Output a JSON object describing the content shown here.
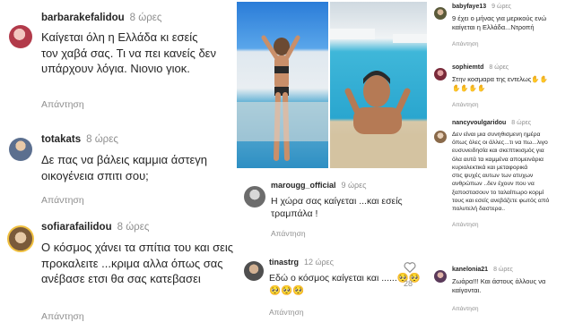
{
  "left": {
    "comments": [
      {
        "username": "barbarakefalidou",
        "time": "8 ώρες",
        "lines": [
          "Καίγεται όλη η Ελλάδα  κι εσείς",
          "τον χαβά σας. Τι να πει κανείς δεν",
          "υπάρχουν λόγια. Νιονιο γιοκ."
        ],
        "reply": "Απάντηση"
      },
      {
        "username": "totakats",
        "time": "8 ώρες",
        "lines": [
          "Δε πας να βάλεις καμμια άστεγη",
          "οικογένεια σπιτι σου;"
        ],
        "reply": "Απάντηση"
      },
      {
        "username": "sofiarafailidou",
        "time": "8 ώρες",
        "lines": [
          "Ο κόσμος χάνει τα σπίτια του και σεις",
          "προκαλειτε ...κριμα αλλα όπως σας",
          "ανέβασε ετσι θα σας κατεβασει"
        ],
        "reply": "Απάντηση"
      }
    ]
  },
  "middle": {
    "comments": [
      {
        "username": "marougg_official",
        "time": "9 ώρες",
        "lines": [
          "Η χώρα σας καίγεται ...και εσείς",
          "τραμπάλα !"
        ],
        "reply": "Απάντηση"
      },
      {
        "username": "tinastrg",
        "time": "12 ώρες",
        "lines": [
          "Εδώ ο κόσμος καίγεται και ......🥺🥺",
          "🥺🥺🥺"
        ],
        "reply": "Απάντηση",
        "likes": "28"
      }
    ]
  },
  "right": {
    "comments": [
      {
        "username": "babyfaye13",
        "time": "9 ώρες",
        "lines": [
          "9 έχει ο μήνας για μερικούς ενώ",
          "καίγεται η Ελλάδα...Ντροπή"
        ],
        "reply": "Απάντηση"
      },
      {
        "username": "sophiemtd",
        "time": "8 ώρες",
        "lines": [
          "Στην κοσμαρα της εντελως✋✋",
          "✋✋✋✋"
        ],
        "reply": "Απάντηση"
      },
      {
        "username": "nancyvoulgaridou",
        "time": "8 ώρες",
        "lines": [
          "Δεν είναι μια συνηθισμενη ημέρα",
          "όπως όλες οι άλλες...τι να πω...λιγο",
          "ευσυνειδησία και σκεπτικισμός για",
          "όλα αυτά τα καμμένα απομεινάρια",
          "κυριολεκτικά και μεταφορικά",
          "στις ψυχές αυτων των ατυχων",
          "ανθρώπων ..δεν έχουν που να",
          "ξαποστασουν το ταλαίπωρο κορμί",
          "τους και εσείς ανεβάζετε φωτός από",
          "πολυτελή δαστερα.."
        ],
        "reply": "Απάντηση"
      },
      {
        "username": "kanelonia21",
        "time": "8 ώρες",
        "lines": [
          "Ζωάρα!!! Και άστους άλλους να",
          "καίγονται."
        ],
        "reply": "Απάντηση"
      }
    ]
  }
}
